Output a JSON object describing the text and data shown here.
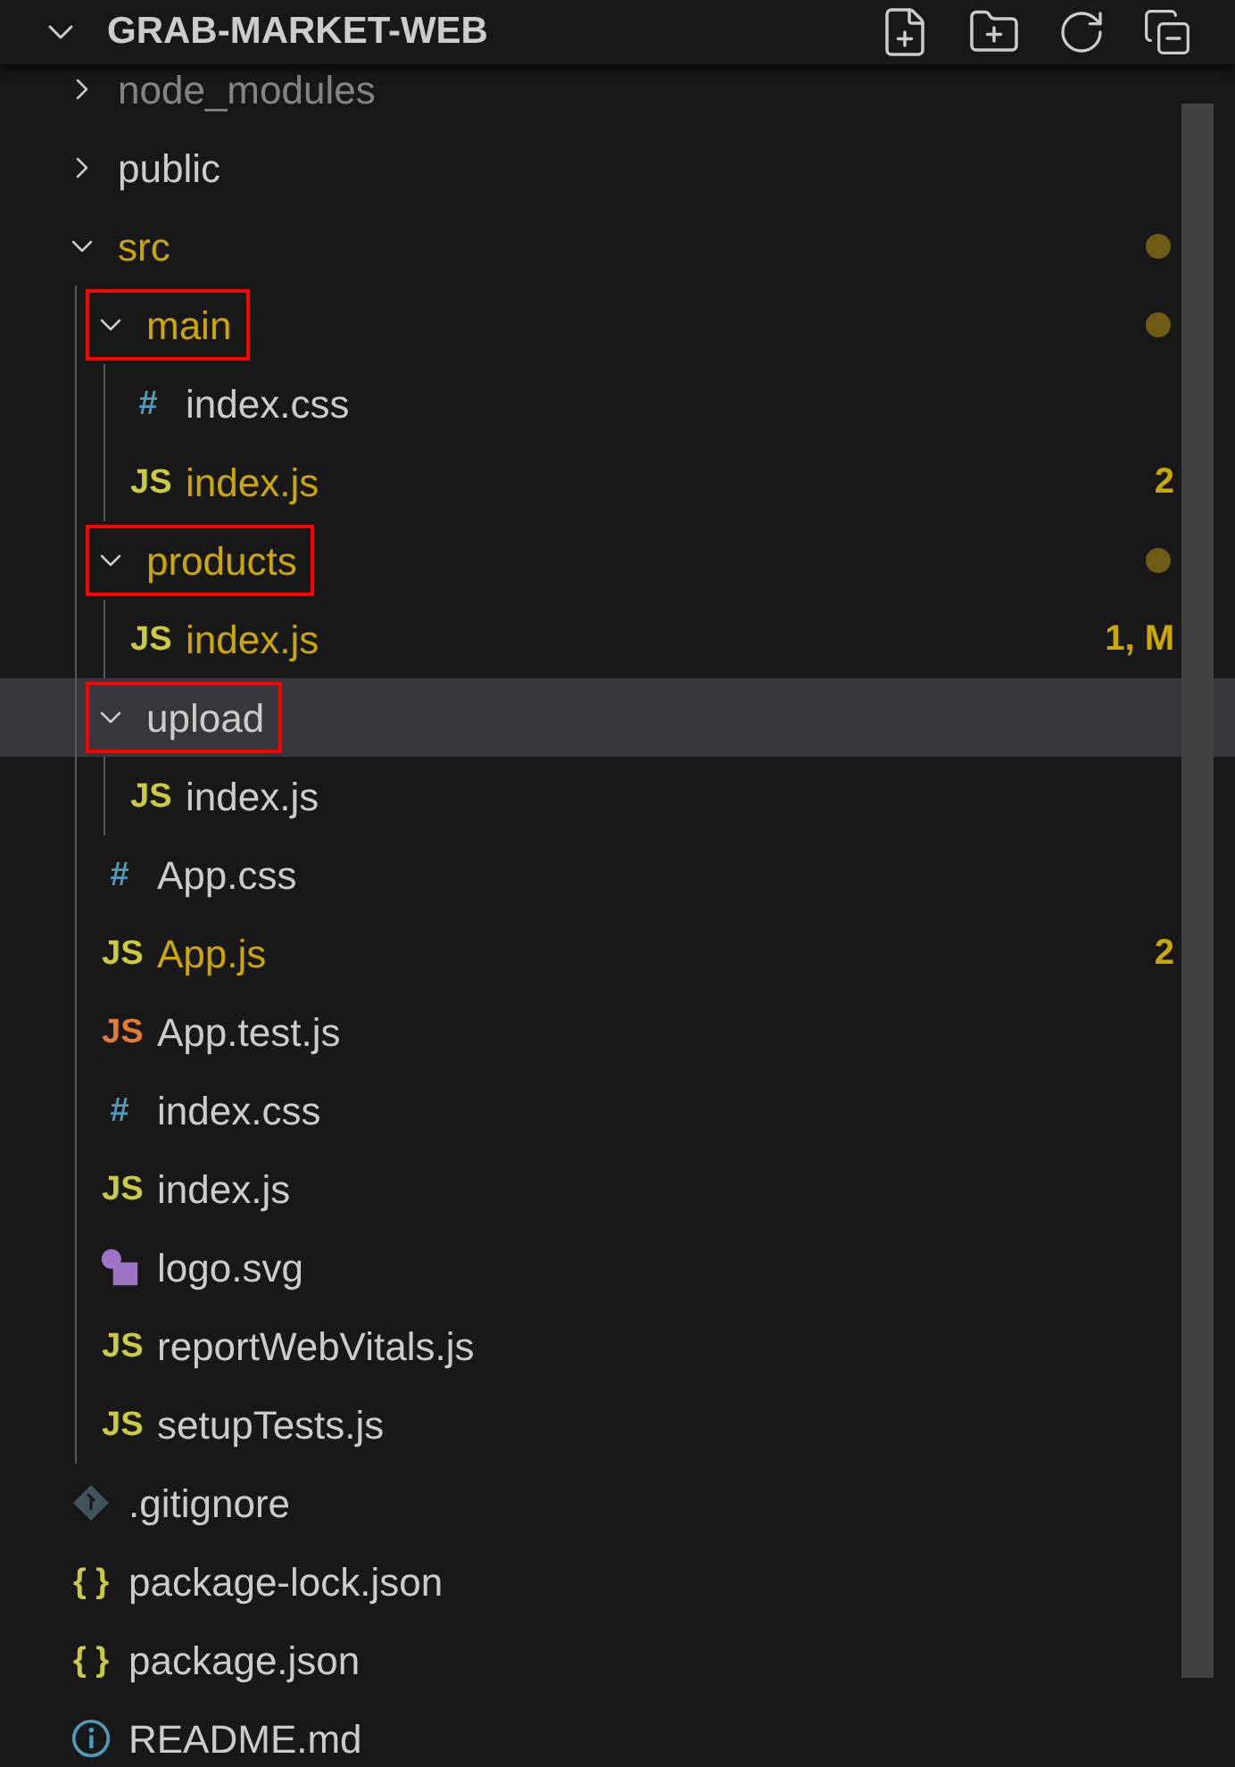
{
  "explorer": {
    "title": "GRAB-MARKET-WEB",
    "expanded": true
  },
  "tree": [
    {
      "kind": "folder",
      "name": "node_modules",
      "expanded": false,
      "selected": false,
      "highlighted": false,
      "modified": false,
      "ignored": true
    },
    {
      "kind": "folder",
      "name": "public",
      "expanded": false,
      "selected": false,
      "highlighted": false,
      "modified": false,
      "ignored": false
    },
    {
      "kind": "folder",
      "name": "src",
      "expanded": true,
      "selected": false,
      "highlighted": false,
      "modified": true,
      "ignored": false,
      "dot": true,
      "children": [
        {
          "kind": "folder",
          "name": "main",
          "expanded": true,
          "selected": false,
          "highlighted": true,
          "modified": true,
          "ignored": false,
          "dot": true,
          "children": [
            {
              "kind": "file",
              "name": "index.css",
              "selected": false,
              "highlighted": false,
              "modified": false,
              "ignored": false,
              "icon": {
                "kind": "glyph",
                "text": "#",
                "color": "#519aba"
              }
            },
            {
              "kind": "file",
              "name": "index.js",
              "selected": false,
              "highlighted": false,
              "modified": true,
              "ignored": false,
              "badge": "2",
              "icon": {
                "kind": "glyph",
                "text": "JS",
                "color": "#cbcb41"
              }
            }
          ]
        },
        {
          "kind": "folder",
          "name": "products",
          "expanded": true,
          "selected": false,
          "highlighted": true,
          "modified": true,
          "ignored": false,
          "dot": true,
          "children": [
            {
              "kind": "file",
              "name": "index.js",
              "selected": false,
              "highlighted": false,
              "modified": true,
              "ignored": false,
              "badge": "1, M",
              "icon": {
                "kind": "glyph",
                "text": "JS",
                "color": "#cbcb41"
              }
            }
          ]
        },
        {
          "kind": "folder",
          "name": "upload",
          "expanded": true,
          "selected": true,
          "highlighted": true,
          "modified": false,
          "ignored": false,
          "children": [
            {
              "kind": "file",
              "name": "index.js",
              "selected": false,
              "highlighted": false,
              "modified": false,
              "ignored": false,
              "icon": {
                "kind": "glyph",
                "text": "JS",
                "color": "#cbcb41"
              }
            }
          ]
        },
        {
          "kind": "file",
          "name": "App.css",
          "selected": false,
          "highlighted": false,
          "modified": false,
          "ignored": false,
          "icon": {
            "kind": "glyph",
            "text": "#",
            "color": "#519aba"
          }
        },
        {
          "kind": "file",
          "name": "App.js",
          "selected": false,
          "highlighted": false,
          "modified": true,
          "ignored": false,
          "badge": "2",
          "icon": {
            "kind": "glyph",
            "text": "JS",
            "color": "#cbcb41"
          }
        },
        {
          "kind": "file",
          "name": "App.test.js",
          "selected": false,
          "highlighted": false,
          "modified": false,
          "ignored": false,
          "icon": {
            "kind": "glyph",
            "text": "JS",
            "color": "#e37933"
          }
        },
        {
          "kind": "file",
          "name": "index.css",
          "selected": false,
          "highlighted": false,
          "modified": false,
          "ignored": false,
          "icon": {
            "kind": "glyph",
            "text": "#",
            "color": "#519aba"
          }
        },
        {
          "kind": "file",
          "name": "index.js",
          "selected": false,
          "highlighted": false,
          "modified": false,
          "ignored": false,
          "icon": {
            "kind": "glyph",
            "text": "JS",
            "color": "#cbcb41"
          }
        },
        {
          "kind": "file",
          "name": "logo.svg",
          "selected": false,
          "highlighted": false,
          "modified": false,
          "ignored": false,
          "icon": {
            "kind": "shapes"
          }
        },
        {
          "kind": "file",
          "name": "reportWebVitals.js",
          "selected": false,
          "highlighted": false,
          "modified": false,
          "ignored": false,
          "icon": {
            "kind": "glyph",
            "text": "JS",
            "color": "#cbcb41"
          }
        },
        {
          "kind": "file",
          "name": "setupTests.js",
          "selected": false,
          "highlighted": false,
          "modified": false,
          "ignored": false,
          "icon": {
            "kind": "glyph",
            "text": "JS",
            "color": "#cbcb41"
          }
        }
      ]
    },
    {
      "kind": "file",
      "name": ".gitignore",
      "selected": false,
      "highlighted": false,
      "modified": false,
      "ignored": false,
      "icon": {
        "kind": "diamond"
      }
    },
    {
      "kind": "file",
      "name": "package-lock.json",
      "selected": false,
      "highlighted": false,
      "modified": false,
      "ignored": false,
      "icon": {
        "kind": "glyph",
        "text": "{ }",
        "color": "#cbcb41"
      }
    },
    {
      "kind": "file",
      "name": "package.json",
      "selected": false,
      "highlighted": false,
      "modified": false,
      "ignored": false,
      "icon": {
        "kind": "glyph",
        "text": "{ }",
        "color": "#cbcb41"
      }
    },
    {
      "kind": "file",
      "name": "README.md",
      "selected": false,
      "highlighted": false,
      "modified": false,
      "ignored": false,
      "icon": {
        "kind": "info"
      }
    }
  ]
}
